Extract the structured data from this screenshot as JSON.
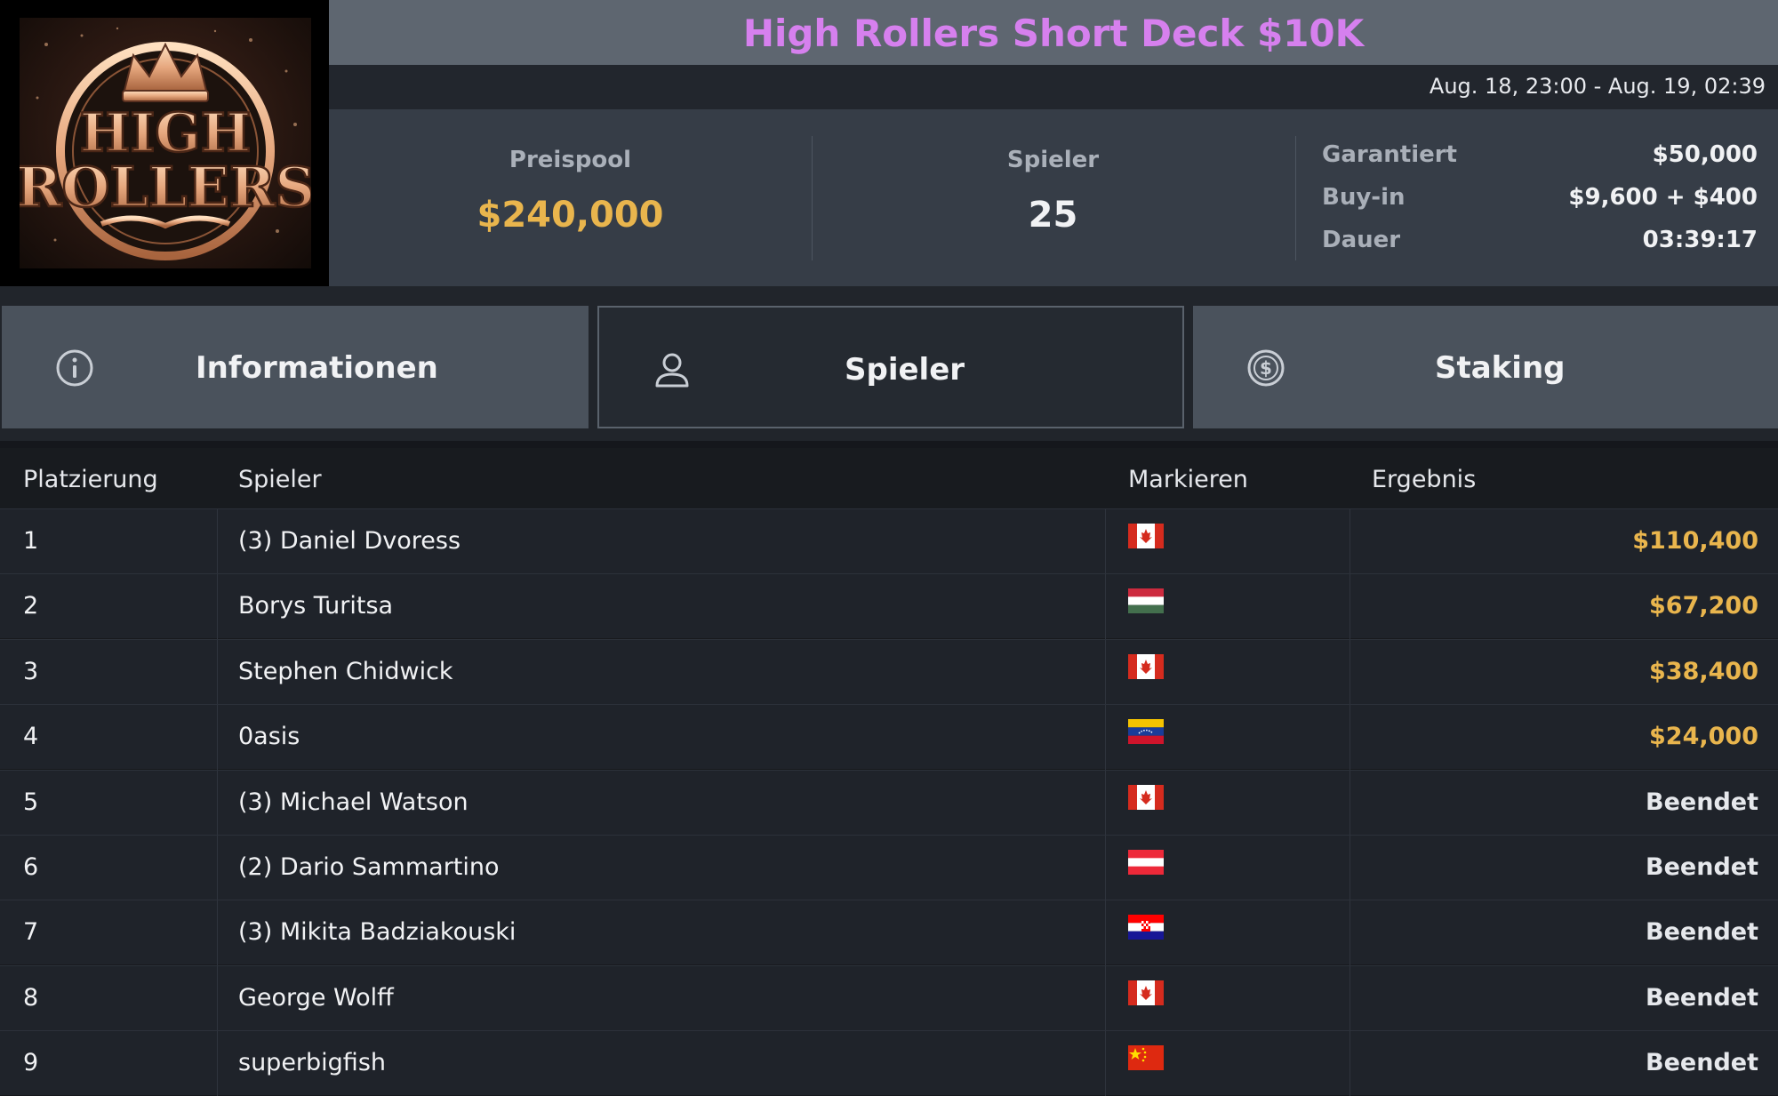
{
  "logo": {
    "line1": "HIGH",
    "line2": "ROLLERS"
  },
  "tournament": {
    "title": "High Rollers Short Deck $10K",
    "date_range": "Aug. 18, 23:00 - Aug. 19, 02:39"
  },
  "summary": {
    "prize_pool_label": "Preispool",
    "prize_pool_value": "$240,000",
    "players_label": "Spieler",
    "players_value": "25",
    "details": [
      {
        "label": "Garantiert",
        "value": "$50,000"
      },
      {
        "label": "Buy-in",
        "value": "$9,600 + $400"
      },
      {
        "label": "Dauer",
        "value": "03:39:17"
      }
    ]
  },
  "tabs": [
    {
      "label": "Informationen",
      "icon": "info-icon",
      "active": false
    },
    {
      "label": "Spieler",
      "icon": "user-icon",
      "active": true
    },
    {
      "label": "Staking",
      "icon": "dollar-coin-icon",
      "active": false
    }
  ],
  "table": {
    "headers": {
      "place": "Platzierung",
      "player": "Spieler",
      "flag": "Markieren",
      "result": "Ergebnis"
    },
    "rows": [
      {
        "place": "1",
        "player": "(3) Daniel Dvoress",
        "flag": "canada-flag-icon",
        "result": "$110,400"
      },
      {
        "place": "2",
        "player": "Borys Turitsa",
        "flag": "hungary-flag-icon",
        "result": "$67,200"
      },
      {
        "place": "3",
        "player": "Stephen Chidwick",
        "flag": "canada-flag-icon",
        "result": "$38,400"
      },
      {
        "place": "4",
        "player": "0asis",
        "flag": "venezuela-flag-icon",
        "result": "$24,000"
      },
      {
        "place": "5",
        "player": "(3) Michael Watson",
        "flag": "canada-flag-icon",
        "result": "Beendet"
      },
      {
        "place": "6",
        "player": "(2) Dario Sammartino",
        "flag": "austria-flag-icon",
        "result": "Beendet"
      },
      {
        "place": "7",
        "player": "(3) Mikita Badziakouski",
        "flag": "croatia-flag-icon",
        "result": "Beendet"
      },
      {
        "place": "8",
        "player": "George Wolff",
        "flag": "canada-flag-icon",
        "result": "Beendet"
      },
      {
        "place": "9",
        "player": "superbigfish",
        "flag": "china-flag-icon",
        "result": "Beendet"
      }
    ]
  },
  "colors": {
    "title": "#d680ee",
    "money": "#e9b54d",
    "tab_inactive": "#4a525c",
    "tab_active": "#252a31"
  }
}
